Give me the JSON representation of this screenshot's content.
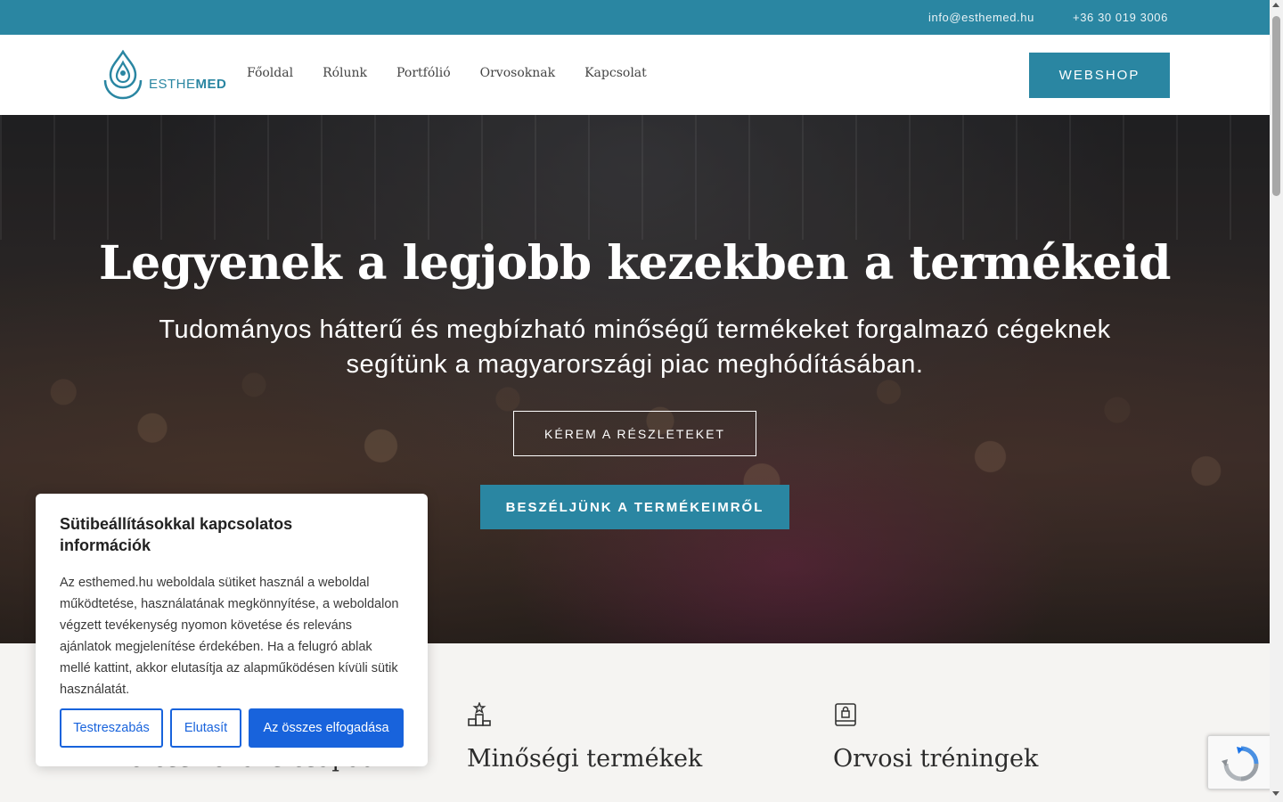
{
  "topbar": {
    "email": "info@esthemed.hu",
    "phone": "+36 30 019 3006"
  },
  "brand": {
    "name_light": "ESTHE",
    "name_bold": "MED"
  },
  "nav": {
    "items": [
      "Főoldal",
      "Rólunk",
      "Portfólió",
      "Orvosoknak",
      "Kapcsolat"
    ]
  },
  "header": {
    "webshop_label": "WEBSHOP"
  },
  "hero": {
    "title": "Legyenek a legjobb kezekben a termékeid",
    "subtitle": "Tudományos hátterű és megbízható minőségű termékeket forgalmazó cégeknek segítünk a magyarországi piac meghódításában.",
    "details_label": "KÉREM A RÉSZLETEKET",
    "products_label": "BESZÉLJÜNK A TERMÉKEIMRŐL"
  },
  "features": [
    {
      "title": "Professzionális csapat",
      "icon": "team-icon"
    },
    {
      "title": "Minőségi termékek",
      "icon": "podium-icon"
    },
    {
      "title": "Orvosi tréningek",
      "icon": "locked-book-icon"
    }
  ],
  "cookie": {
    "title": "Sütibeállításokkal kapcsolatos információk",
    "text": "Az esthemed.hu weboldala sütiket használ a weboldal működtetése, használatának megkönnyítése, a weboldalon végzett tevékenység nyomon követése és releváns ajánlatok megjelenítése érdekében. Ha a felugró ablak mellé kattint, akkor elutasítja az alapműködésen kívüli sütik használatát.",
    "customize_label": "Testreszabás",
    "reject_label": "Elutasít",
    "accept_label": "Az összes elfogadása"
  },
  "colors": {
    "brand": "#2a86a2",
    "cookie_accent": "#1863dc"
  }
}
